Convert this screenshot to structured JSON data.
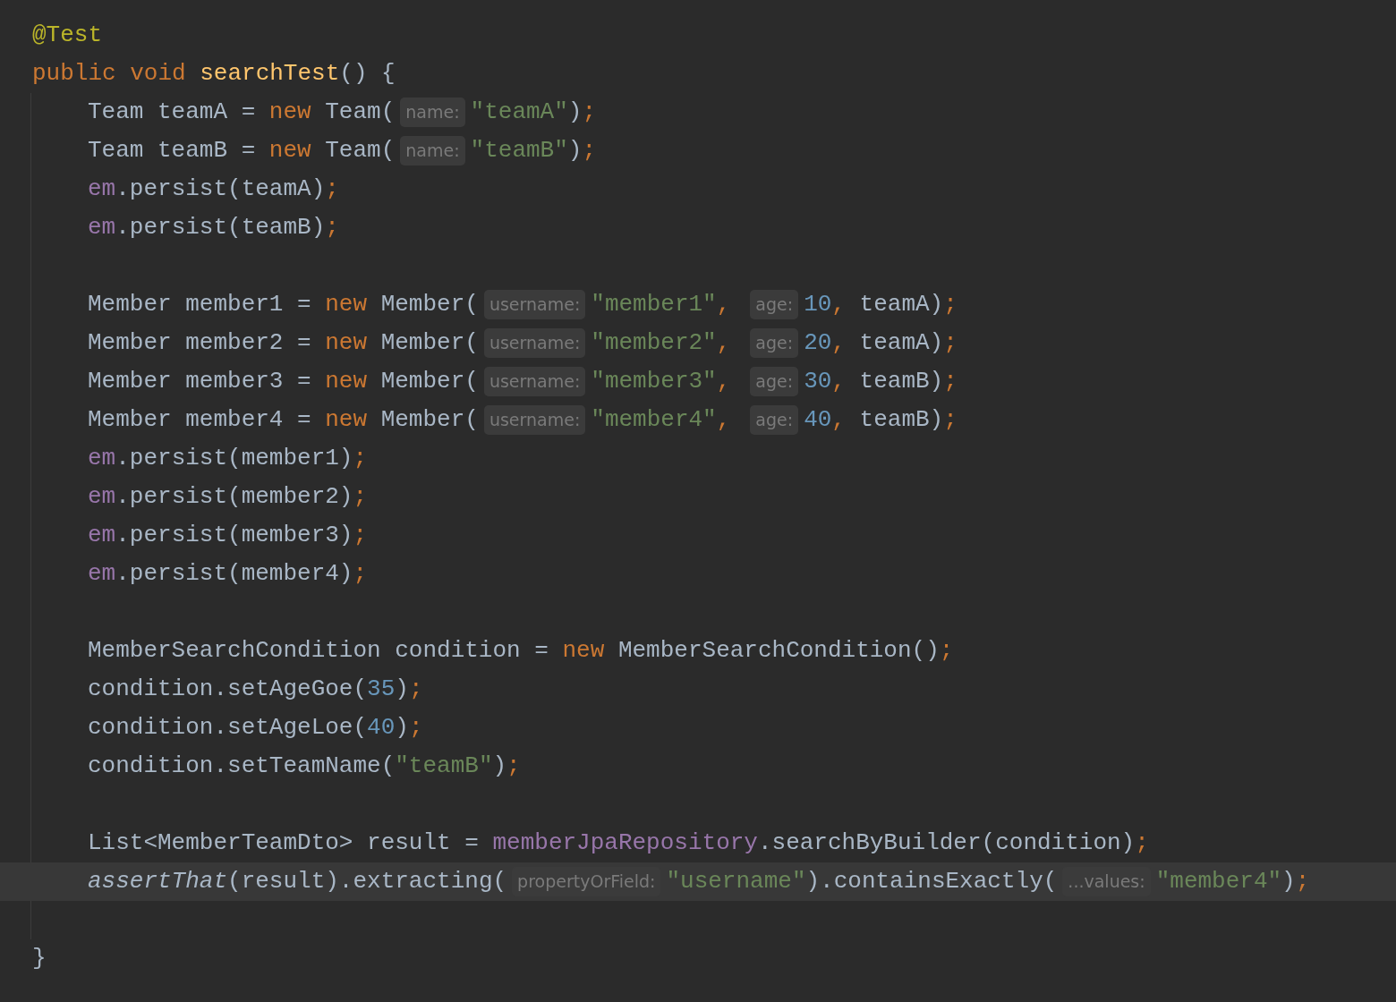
{
  "code": [
    {
      "current": false,
      "tokens": [
        {
          "kind": "annotation",
          "text": "@Test"
        }
      ]
    },
    {
      "current": false,
      "tokens": [
        {
          "kind": "keyword",
          "text": "public void"
        },
        {
          "kind": "method",
          "text": " searchTest"
        },
        {
          "kind": "plain",
          "text": "() {"
        }
      ],
      "children": [
        {
          "current": false,
          "tokens": [
            {
              "kind": "plain",
              "text": "Team teamA = "
            },
            {
              "kind": "keyword",
              "text": "new"
            },
            {
              "kind": "plain",
              "text": " Team("
            },
            {
              "kind": "hint",
              "text": "name:"
            },
            {
              "kind": "string",
              "text": "\"teamA\""
            },
            {
              "kind": "plain",
              "text": ")"
            },
            {
              "kind": "punct",
              "text": ";"
            }
          ]
        },
        {
          "current": false,
          "tokens": [
            {
              "kind": "plain",
              "text": "Team teamB = "
            },
            {
              "kind": "keyword",
              "text": "new"
            },
            {
              "kind": "plain",
              "text": " Team("
            },
            {
              "kind": "hint",
              "text": "name:"
            },
            {
              "kind": "string",
              "text": "\"teamB\""
            },
            {
              "kind": "plain",
              "text": ")"
            },
            {
              "kind": "punct",
              "text": ";"
            }
          ]
        },
        {
          "current": false,
          "tokens": [
            {
              "kind": "field",
              "text": "em"
            },
            {
              "kind": "plain",
              "text": ".persist(teamA)"
            },
            {
              "kind": "punct",
              "text": ";"
            }
          ]
        },
        {
          "current": false,
          "tokens": [
            {
              "kind": "field",
              "text": "em"
            },
            {
              "kind": "plain",
              "text": ".persist(teamB)"
            },
            {
              "kind": "punct",
              "text": ";"
            }
          ]
        },
        {
          "current": false
        },
        {
          "current": false,
          "tokens": [
            {
              "kind": "plain",
              "text": "Member member1 = "
            },
            {
              "kind": "keyword",
              "text": "new"
            },
            {
              "kind": "plain",
              "text": " Member("
            },
            {
              "kind": "hint",
              "text": "username:"
            },
            {
              "kind": "string",
              "text": "\"member1\""
            },
            {
              "kind": "punct",
              "text": ","
            },
            {
              "kind": "hint",
              "text": "age:"
            },
            {
              "kind": "number",
              "text": "10"
            },
            {
              "kind": "punct",
              "text": ","
            },
            {
              "kind": "plain",
              "text": " teamA)"
            },
            {
              "kind": "punct",
              "text": ";"
            }
          ]
        },
        {
          "current": false,
          "tokens": [
            {
              "kind": "plain",
              "text": "Member member2 = "
            },
            {
              "kind": "keyword",
              "text": "new"
            },
            {
              "kind": "plain",
              "text": " Member("
            },
            {
              "kind": "hint",
              "text": "username:"
            },
            {
              "kind": "string",
              "text": "\"member2\""
            },
            {
              "kind": "punct",
              "text": ","
            },
            {
              "kind": "hint",
              "text": "age:"
            },
            {
              "kind": "number",
              "text": "20"
            },
            {
              "kind": "punct",
              "text": ","
            },
            {
              "kind": "plain",
              "text": " teamA)"
            },
            {
              "kind": "punct",
              "text": ";"
            }
          ]
        },
        {
          "current": false,
          "tokens": [
            {
              "kind": "plain",
              "text": "Member member3 = "
            },
            {
              "kind": "keyword",
              "text": "new"
            },
            {
              "kind": "plain",
              "text": " Member("
            },
            {
              "kind": "hint",
              "text": "username:"
            },
            {
              "kind": "string",
              "text": "\"member3\""
            },
            {
              "kind": "punct",
              "text": ","
            },
            {
              "kind": "hint",
              "text": "age:"
            },
            {
              "kind": "number",
              "text": "30"
            },
            {
              "kind": "punct",
              "text": ","
            },
            {
              "kind": "plain",
              "text": " teamB)"
            },
            {
              "kind": "punct",
              "text": ";"
            }
          ]
        },
        {
          "current": false,
          "tokens": [
            {
              "kind": "plain",
              "text": "Member member4 = "
            },
            {
              "kind": "keyword",
              "text": "new"
            },
            {
              "kind": "plain",
              "text": " Member("
            },
            {
              "kind": "hint",
              "text": "username:"
            },
            {
              "kind": "string",
              "text": "\"member4\""
            },
            {
              "kind": "punct",
              "text": ","
            },
            {
              "kind": "hint",
              "text": "age:"
            },
            {
              "kind": "number",
              "text": "40"
            },
            {
              "kind": "punct",
              "text": ","
            },
            {
              "kind": "plain",
              "text": " teamB)"
            },
            {
              "kind": "punct",
              "text": ";"
            }
          ]
        },
        {
          "current": false,
          "tokens": [
            {
              "kind": "field",
              "text": "em"
            },
            {
              "kind": "plain",
              "text": ".persist(member1)"
            },
            {
              "kind": "punct",
              "text": ";"
            }
          ]
        },
        {
          "current": false,
          "tokens": [
            {
              "kind": "field",
              "text": "em"
            },
            {
              "kind": "plain",
              "text": ".persist(member2)"
            },
            {
              "kind": "punct",
              "text": ";"
            }
          ]
        },
        {
          "current": false,
          "tokens": [
            {
              "kind": "field",
              "text": "em"
            },
            {
              "kind": "plain",
              "text": ".persist(member3)"
            },
            {
              "kind": "punct",
              "text": ";"
            }
          ]
        },
        {
          "current": false,
          "tokens": [
            {
              "kind": "field",
              "text": "em"
            },
            {
              "kind": "plain",
              "text": ".persist(member4)"
            },
            {
              "kind": "punct",
              "text": ";"
            }
          ]
        },
        {
          "current": false
        },
        {
          "current": false,
          "tokens": [
            {
              "kind": "plain",
              "text": "MemberSearchCondition condition = "
            },
            {
              "kind": "keyword",
              "text": "new"
            },
            {
              "kind": "plain",
              "text": " MemberSearchCondition()"
            },
            {
              "kind": "punct",
              "text": ";"
            }
          ]
        },
        {
          "current": false,
          "tokens": [
            {
              "kind": "plain",
              "text": "condition.setAgeGoe("
            },
            {
              "kind": "number",
              "text": "35"
            },
            {
              "kind": "plain",
              "text": ")"
            },
            {
              "kind": "punct",
              "text": ";"
            }
          ]
        },
        {
          "current": false,
          "tokens": [
            {
              "kind": "plain",
              "text": "condition.setAgeLoe("
            },
            {
              "kind": "number",
              "text": "40"
            },
            {
              "kind": "plain",
              "text": ")"
            },
            {
              "kind": "punct",
              "text": ";"
            }
          ]
        },
        {
          "current": false,
          "tokens": [
            {
              "kind": "plain",
              "text": "condition.setTeamName("
            },
            {
              "kind": "string",
              "text": "\"teamB\""
            },
            {
              "kind": "plain",
              "text": ")"
            },
            {
              "kind": "punct",
              "text": ";"
            }
          ]
        },
        {
          "current": false
        },
        {
          "current": false,
          "tokens": [
            {
              "kind": "plain",
              "text": "List<MemberTeamDto> result = "
            },
            {
              "kind": "field",
              "text": "memberJpaRepository"
            },
            {
              "kind": "plain",
              "text": ".searchByBuilder(condition)"
            },
            {
              "kind": "punct",
              "text": ";"
            }
          ]
        },
        {
          "current": true,
          "tokens": [
            {
              "kind": "static",
              "text": "assertThat"
            },
            {
              "kind": "plain",
              "text": "(result).extracting("
            },
            {
              "kind": "hint",
              "text": "propertyOrField:"
            },
            {
              "kind": "string",
              "text": "\"username\""
            },
            {
              "kind": "plain",
              "text": ").containsExactly("
            },
            {
              "kind": "hint",
              "text": "...values:"
            },
            {
              "kind": "string",
              "text": "\"member4\""
            },
            {
              "kind": "plain",
              "text": ")"
            },
            {
              "kind": "punct",
              "text": ";"
            }
          ]
        },
        {
          "current": false
        }
      ]
    },
    {
      "current": false,
      "tokens": [
        {
          "kind": "plain",
          "text": "}"
        }
      ]
    }
  ]
}
